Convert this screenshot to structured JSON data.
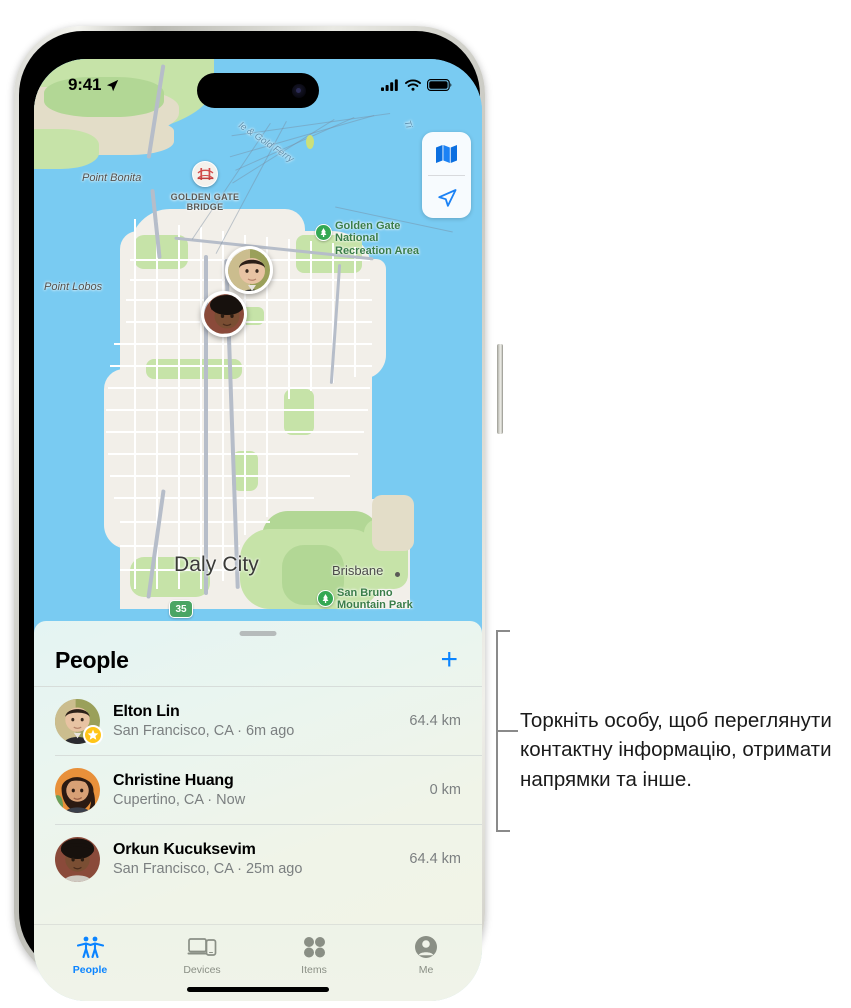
{
  "status_bar": {
    "time": "9:41",
    "location_icon": "location-arrow-icon",
    "cellular_icon": "cellular-bars-icon",
    "wifi_icon": "wifi-icon",
    "battery_icon": "battery-icon"
  },
  "map": {
    "controls": [
      {
        "name": "map-mode-button",
        "icon": "folded-map-icon"
      },
      {
        "name": "locate-me-button",
        "icon": "navigation-arrow-icon"
      }
    ],
    "labels": {
      "point_bonita": "Point Bonita",
      "point_lobos": "Point Lobos",
      "golden_gate_bridge": "GOLDEN GATE\nBRIDGE",
      "ggnra": "Golden Gate\nNational\nRecreation Area",
      "daly_city": "Daly City",
      "brisbane": "Brisbane",
      "san_bruno": "San Bruno\nMountain Park",
      "ferry_route": "le & Gold Ferry",
      "ferry_route2": "Ti",
      "route_shield": "35"
    },
    "pins": [
      {
        "name": "map-avatar-pin-elton",
        "person": "Elton Lin"
      },
      {
        "name": "map-avatar-pin-orkun",
        "person": "Orkun Kucuksevim"
      }
    ]
  },
  "sheet": {
    "title": "People",
    "add_label": "+",
    "people": [
      {
        "name": "Elton Lin",
        "subtitle": "San Francisco, CA · 6m ago",
        "distance": "64.4 km",
        "badge": "star-badge"
      },
      {
        "name": "Christine Huang",
        "subtitle": "Cupertino, CA · Now",
        "distance": "0 km",
        "badge": ""
      },
      {
        "name": "Orkun Kucuksevim",
        "subtitle": "San Francisco, CA · 25m ago",
        "distance": "64.4 km",
        "badge": ""
      }
    ]
  },
  "tabbar": {
    "tabs": [
      {
        "label": "People",
        "icon": "people-icon",
        "active": true
      },
      {
        "label": "Devices",
        "icon": "devices-icon",
        "active": false
      },
      {
        "label": "Items",
        "icon": "items-icon",
        "active": false
      },
      {
        "label": "Me",
        "icon": "person-circle-icon",
        "active": false
      }
    ]
  },
  "callout": {
    "text": "Торкніть особу, щоб переглянути контактну інформацію, отримати напрямки та інше."
  },
  "colors": {
    "accent_blue": "#0b84ff",
    "water": "#79cbf2",
    "land": "#f2efe9",
    "park_green": "#c6e3a8",
    "star_gold": "#ffc518",
    "tab_inactive": "#8a8f85"
  }
}
